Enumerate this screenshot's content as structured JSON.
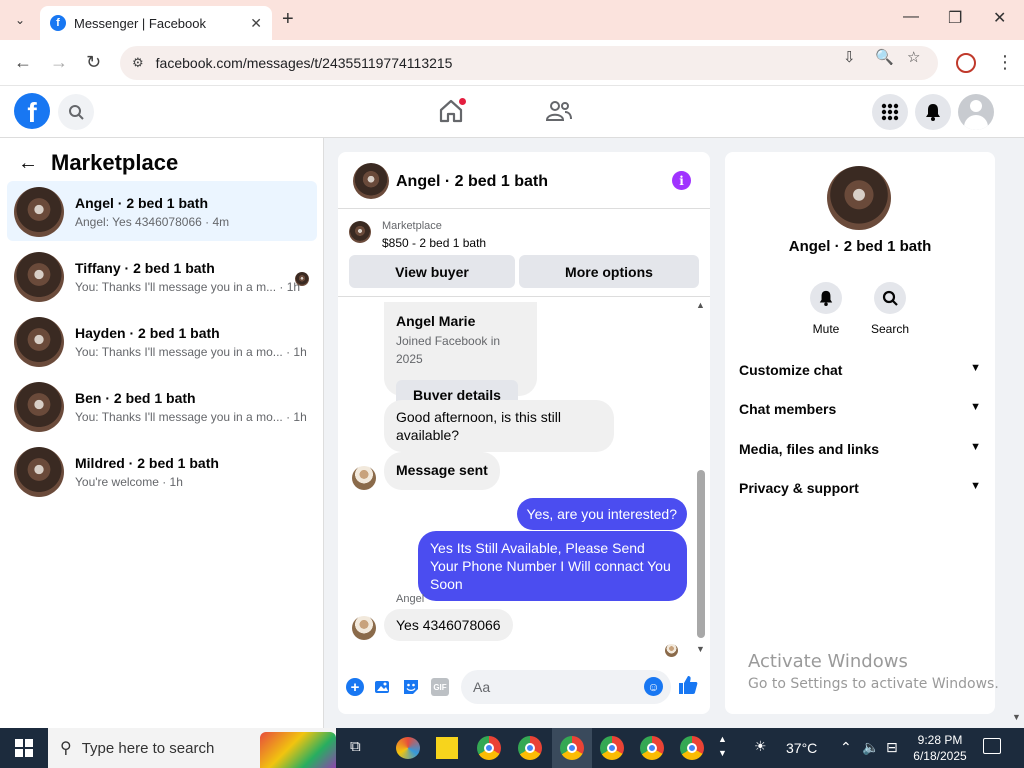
{
  "browser": {
    "tab_title": "Messenger | Facebook",
    "url": "facebook.com/messages/t/24355119774113215"
  },
  "header": {
    "logo_letter": "f"
  },
  "left": {
    "title": "Marketplace",
    "conversations": [
      {
        "name": "Angel · 2 bed 1 bath",
        "snippet": "Angel: Yes 4346078066 · 4m"
      },
      {
        "name": "Tiffany · 2 bed 1 bath",
        "snippet": "You: Thanks I'll message you in a m... · 1h"
      },
      {
        "name": "Hayden · 2 bed 1 bath",
        "snippet": "You: Thanks I'll message you in a mo... · 1h"
      },
      {
        "name": "Ben · 2 bed 1 bath",
        "snippet": "You: Thanks I'll message you in a mo... · 1h"
      },
      {
        "name": "Mildred · 2 bed 1 bath",
        "snippet": "You're welcome · 1h"
      }
    ]
  },
  "chat": {
    "title": "Angel · 2 bed 1 bath",
    "listing_source": "Marketplace",
    "listing_price": "$850 - 2 bed 1 bath",
    "view_buyer": "View buyer",
    "more_options": "More options",
    "buyer_name": "Angel Marie",
    "buyer_joined": "Joined Facebook in 2025",
    "buyer_details": "Buyer details",
    "messages": [
      {
        "text": "Good afternoon, is this still available?"
      },
      {
        "text": "Message sent"
      },
      {
        "text": "Yes, are you interested?"
      },
      {
        "text": "Yes Its Still Available, Please Send Your Phone Number I Will connact You Soon"
      },
      {
        "text": "Yes 4346078066"
      }
    ],
    "sender_label": "Angel",
    "composer_placeholder": "Aa",
    "gif_label": "GIF"
  },
  "details": {
    "name": "Angel · 2 bed 1 bath",
    "mute": "Mute",
    "search": "Search",
    "sections": [
      "Customize chat",
      "Chat members",
      "Media, files and links",
      "Privacy & support"
    ]
  },
  "watermark": {
    "line1": "Activate Windows",
    "line2": "Go to Settings to activate Windows."
  },
  "taskbar": {
    "search_placeholder": "Type here to search",
    "temperature": "37°C",
    "time": "9:28 PM",
    "date": "6/18/2025"
  },
  "colors": {
    "fb_blue": "#1877f2",
    "outgoing_bubble": "#4b4df0",
    "info_purple": "#a033ff"
  }
}
